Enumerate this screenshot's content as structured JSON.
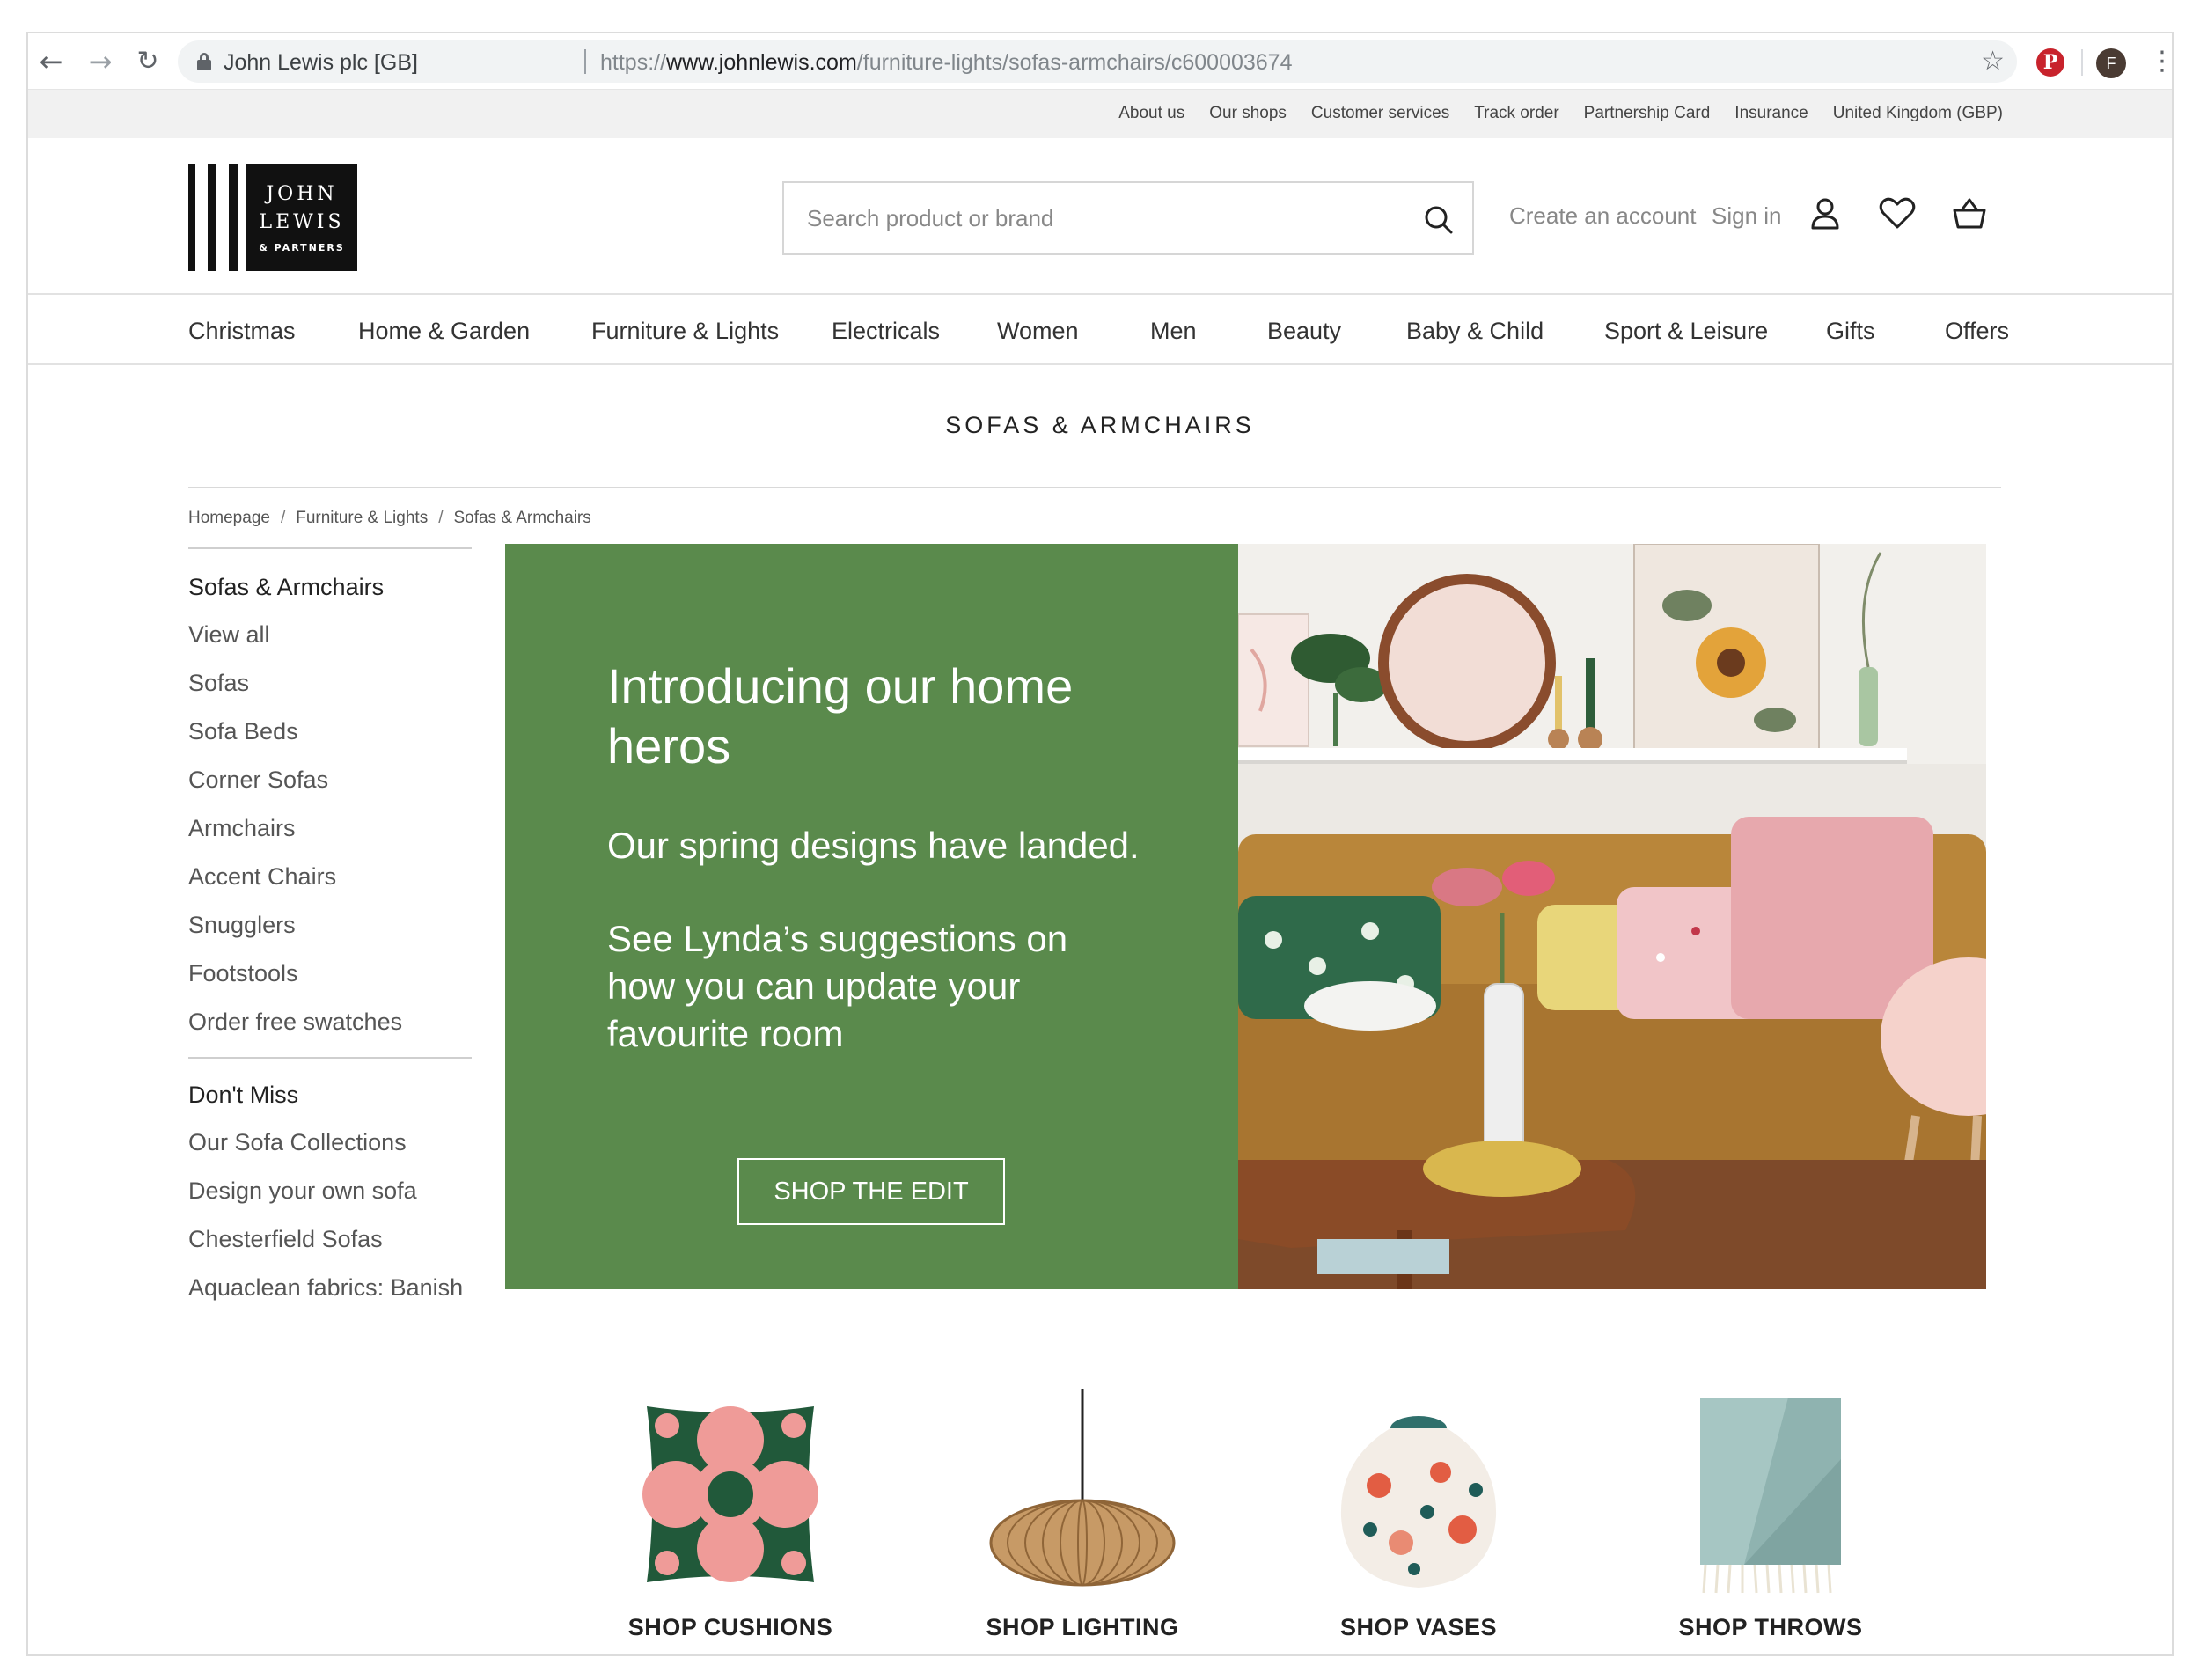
{
  "browser": {
    "site_identity": "John Lewis plc [GB]",
    "url_scheme": "https://",
    "url_host": "www.johnlewis.com",
    "url_path": "/furniture-lights/sofas-armchairs/c600003674",
    "profile_initial": "F"
  },
  "utility_links": [
    "About us",
    "Our shops",
    "Customer services",
    "Track order",
    "Partnership Card",
    "Insurance",
    "United Kingdom (GBP)"
  ],
  "logo": {
    "line1": "JOHN",
    "line2": "LEWIS",
    "line3": "& PARTNERS"
  },
  "search": {
    "placeholder": "Search product or brand"
  },
  "account": {
    "create": "Create an account",
    "sign_in": "Sign in"
  },
  "main_nav": [
    "Christmas",
    "Home & Garden",
    "Furniture & Lights",
    "Electricals",
    "Women",
    "Men",
    "Beauty",
    "Baby & Child",
    "Sport & Leisure",
    "Gifts",
    "Offers"
  ],
  "page_title": "SOFAS & ARMCHAIRS",
  "breadcrumb": [
    "Homepage",
    "Furniture & Lights",
    "Sofas & Armchairs"
  ],
  "sidebar": {
    "section1_heading": "Sofas & Armchairs",
    "section1_items": [
      "View all",
      "Sofas",
      "Sofa Beds",
      "Corner Sofas",
      "Armchairs",
      "Accent Chairs",
      "Snugglers",
      "Footstools",
      "Order free swatches"
    ],
    "section2_heading": "Don't Miss",
    "section2_items": [
      "Our Sofa Collections",
      "Design your own sofa",
      "Chesterfield Sofas",
      "Aquaclean fabrics: Banish"
    ]
  },
  "hero": {
    "heading": "Introducing our home heros",
    "line1": "Our spring designs have landed.",
    "line2": "See Lynda’s suggestions on how you can update your favourite room",
    "button": "SHOP THE EDIT",
    "bg_color": "#5a8a4c"
  },
  "tiles": [
    {
      "label": "SHOP CUSHIONS",
      "icon": "cushion-image"
    },
    {
      "label": "SHOP LIGHTING",
      "icon": "pendant-lamp-image"
    },
    {
      "label": "SHOP VASES",
      "icon": "vase-image"
    },
    {
      "label": "SHOP THROWS",
      "icon": "throw-blanket-image"
    }
  ]
}
